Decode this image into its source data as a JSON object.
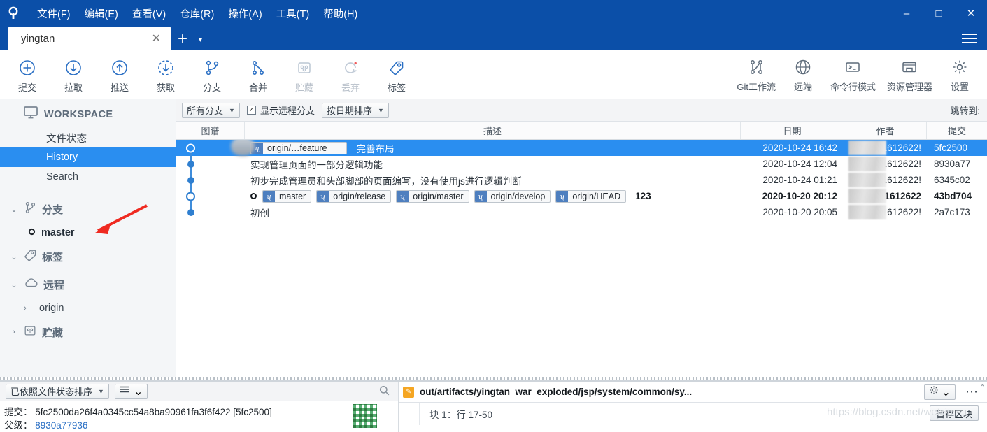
{
  "window": {
    "menus": [
      "文件(F)",
      "编辑(E)",
      "查看(V)",
      "仓库(R)",
      "操作(A)",
      "工具(T)",
      "帮助(H)"
    ],
    "minimize": "–",
    "maximize": "□",
    "close": "✕"
  },
  "tabs": {
    "active": "yingtan",
    "close": "✕",
    "add": "+",
    "caret": "▾"
  },
  "toolbar": {
    "left": [
      {
        "label": "提交",
        "icon": "plus-circle-icon",
        "disabled": false
      },
      {
        "label": "拉取",
        "icon": "arrow-down-circle-icon",
        "disabled": false
      },
      {
        "label": "推送",
        "icon": "arrow-up-circle-icon",
        "disabled": false
      },
      {
        "label": "获取",
        "icon": "arrow-down-dashed-circle-icon",
        "disabled": false
      },
      {
        "label": "分支",
        "icon": "branch-icon",
        "disabled": false
      },
      {
        "label": "合并",
        "icon": "merge-icon",
        "disabled": false
      },
      {
        "label": "贮藏",
        "icon": "stash-icon",
        "disabled": true
      },
      {
        "label": "丢弃",
        "icon": "discard-refresh-icon",
        "disabled": true
      },
      {
        "label": "标签",
        "icon": "tag-icon",
        "disabled": false
      }
    ],
    "right": [
      {
        "label": "Git工作流",
        "icon": "gitflow-icon"
      },
      {
        "label": "远端",
        "icon": "globe-icon"
      },
      {
        "label": "命令行模式",
        "icon": "terminal-icon"
      },
      {
        "label": "资源管理器",
        "icon": "folder-icon"
      },
      {
        "label": "设置",
        "icon": "gear-icon"
      }
    ]
  },
  "sidebar": {
    "workspace_label": "WORKSPACE",
    "items": [
      {
        "label": "文件状态",
        "active": false
      },
      {
        "label": "History",
        "active": true
      },
      {
        "label": "Search",
        "active": false
      }
    ],
    "groups": [
      {
        "label": "分支",
        "icon": "branch-icon",
        "caret": "⌄",
        "children": [
          {
            "label": "master",
            "bold": true
          }
        ]
      },
      {
        "label": "标签",
        "icon": "tag-icon",
        "caret": "⌄",
        "children": []
      },
      {
        "label": "远程",
        "icon": "cloud-icon",
        "caret": "⌄",
        "children": [
          {
            "label": "origin",
            "bold": false,
            "caret": "›"
          }
        ]
      },
      {
        "label": "贮藏",
        "icon": "stash-icon",
        "caret": "›",
        "children": []
      }
    ]
  },
  "filterbar": {
    "branch_filter": "所有分支",
    "show_remote_branches": "显示远程分支",
    "show_remote_checked": "✓",
    "sort_order": "按日期排序",
    "jump_to": "跳转到:"
  },
  "columns": {
    "graph": "图谱",
    "description": "描述",
    "date": "日期",
    "author": "作者",
    "commit": "提交"
  },
  "commits": [
    {
      "refs": [
        {
          "name": "origin/…feature",
          "type": "branch"
        }
      ],
      "message": "完善布局",
      "date": "2020-10-24 16:42",
      "author": ":11612622!",
      "hash": "5fc2500",
      "selected": true,
      "bold": false,
      "node": "ring-sel"
    },
    {
      "refs": [],
      "message": "实现管理页面的一部分逻辑功能",
      "date": "2020-10-24 12:04",
      "author": ":11612622!",
      "hash": "8930a77",
      "selected": false,
      "bold": false,
      "node": "dot"
    },
    {
      "refs": [],
      "message": "初步完成管理员和头部脚部的页面编写，没有使用js进行逻辑判断",
      "date": "2020-10-24 01:21",
      "author": ":11612622!",
      "hash": "6345c02",
      "selected": false,
      "bold": false,
      "node": "dot"
    },
    {
      "refs": [
        {
          "name": "master",
          "type": "local-head"
        },
        {
          "name": "origin/release",
          "type": "branch"
        },
        {
          "name": "origin/master",
          "type": "branch"
        },
        {
          "name": "origin/develop",
          "type": "branch"
        },
        {
          "name": "origin/HEAD",
          "type": "branch"
        }
      ],
      "message": "123",
      "date": "2020-10-20 20:12",
      "author": ":11612622",
      "hash": "43bd704",
      "selected": false,
      "bold": true,
      "node": "ring"
    },
    {
      "refs": [],
      "message": "初创",
      "date": "2020-10-20 20:05",
      "author": ":11612622!",
      "hash": "2a7c173",
      "selected": false,
      "bold": false,
      "node": "dot"
    }
  ],
  "bottom": {
    "sort_files": "已依照文件状态排序",
    "list_icon": "list-icon",
    "list_caret": "⌄",
    "search_icon": "search-icon",
    "commit_label": "提交：",
    "commit_hash": "5fc2500da26f4a0345cc54a8ba90961fa3f6f422 [5fc2500]",
    "parent_label": "父级：",
    "parent_hash": "8930a77936",
    "file_path": "out/artifacts/yingtan_war_exploded/jsp/system/common/sy...",
    "gear_icon": "gear-icon",
    "gear_caret": "⌄",
    "more_icon": "⋯",
    "hunk_label": "块 1：行 17-50",
    "stage_button": "暂存区块",
    "watermark": "https://blog.csdn.net/weixin_...",
    "scroll_up": "⌃"
  },
  "colors": {
    "titlebar": "#0b4fa8",
    "accent": "#2a8ef0",
    "ref_badge": "#4e7fbf",
    "sidebar_bg": "#f4f6f8",
    "annotation_arrow": "#ef2a21"
  }
}
